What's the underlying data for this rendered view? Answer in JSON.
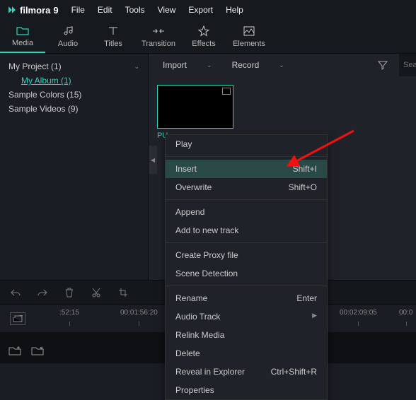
{
  "app": {
    "name": "filmora",
    "version": "9"
  },
  "menubar": [
    "File",
    "Edit",
    "Tools",
    "View",
    "Export",
    "Help"
  ],
  "toolbar": [
    {
      "label": "Media",
      "icon": "folder-icon",
      "active": true
    },
    {
      "label": "Audio",
      "icon": "music-icon"
    },
    {
      "label": "Titles",
      "icon": "titles-icon"
    },
    {
      "label": "Transition",
      "icon": "transition-icon"
    },
    {
      "label": "Effects",
      "icon": "effects-icon"
    },
    {
      "label": "Elements",
      "icon": "elements-icon"
    }
  ],
  "sidebar": {
    "root": "My Project (1)",
    "child": "My Album (1)",
    "items": [
      "Sample Colors (15)",
      "Sample Videos (9)"
    ]
  },
  "content": {
    "import": "Import",
    "record": "Record",
    "thumb_label": "PU",
    "search_placeholder": "Sea"
  },
  "contextmenu": {
    "play": "Play",
    "insert": {
      "label": "Insert",
      "shortcut": "Shift+I"
    },
    "overwrite": {
      "label": "Overwrite",
      "shortcut": "Shift+O"
    },
    "append": "Append",
    "addtrack": "Add to new track",
    "proxy": "Create Proxy file",
    "scene": "Scene Detection",
    "rename": {
      "label": "Rename",
      "shortcut": "Enter"
    },
    "audiotrack": "Audio Track",
    "relink": "Relink Media",
    "delete": "Delete",
    "reveal": {
      "label": "Reveal in Explorer",
      "shortcut": "Ctrl+Shift+R"
    },
    "properties": "Properties"
  },
  "timeline": {
    "ticks": [
      ":52:15",
      "00:01:56:20",
      "00:02:09:05",
      "00:0"
    ]
  }
}
